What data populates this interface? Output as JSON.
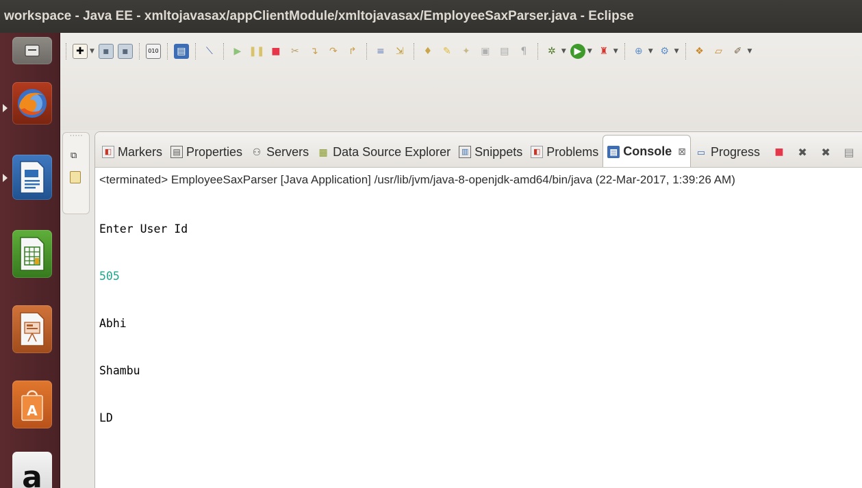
{
  "window": {
    "title": "workspace - Java EE - xmltojavasax/appClientModule/xmltojavasax/EmployeeSaxParser.java - Eclipse"
  },
  "launcher": {
    "items": [
      {
        "name": "show-desktop",
        "icon": "window-icon"
      },
      {
        "name": "firefox",
        "icon": "firefox-icon"
      },
      {
        "name": "libreoffice-writer",
        "icon": "writer-icon"
      },
      {
        "name": "libreoffice-calc",
        "icon": "calc-icon"
      },
      {
        "name": "libreoffice-impress",
        "icon": "impress-icon"
      },
      {
        "name": "ubuntu-software-center",
        "icon": "software-center-icon"
      },
      {
        "name": "amazon",
        "icon": "amazon-icon"
      }
    ],
    "amazon_letter": "a"
  },
  "tabs": [
    {
      "label": "Markers",
      "icon": "markers-icon"
    },
    {
      "label": "Properties",
      "icon": "properties-icon"
    },
    {
      "label": "Servers",
      "icon": "servers-icon"
    },
    {
      "label": "Data Source Explorer",
      "icon": "data-source-icon"
    },
    {
      "label": "Snippets",
      "icon": "snippets-icon"
    },
    {
      "label": "Problems",
      "icon": "problems-icon"
    },
    {
      "label": "Console",
      "icon": "console-icon",
      "active": true
    },
    {
      "label": "Progress",
      "icon": "progress-icon"
    }
  ],
  "tab_close_glyph": "⊠",
  "console": {
    "status": "<terminated> EmployeeSaxParser [Java Application] /usr/lib/jvm/java-8-openjdk-amd64/bin/java (22-Mar-2017, 1:39:26 AM)",
    "lines": [
      {
        "text": "Enter User Id",
        "kind": "output"
      },
      {
        "text": "505",
        "kind": "input"
      },
      {
        "text": "Abhi",
        "kind": "output"
      },
      {
        "text": "Shambu",
        "kind": "output"
      },
      {
        "text": "LD",
        "kind": "output"
      }
    ]
  },
  "colors": {
    "titlebar": "#3d3c38",
    "launcher": "#5b2a2e",
    "console_input": "#1ea78d",
    "terminate_red": "#e5364a"
  }
}
